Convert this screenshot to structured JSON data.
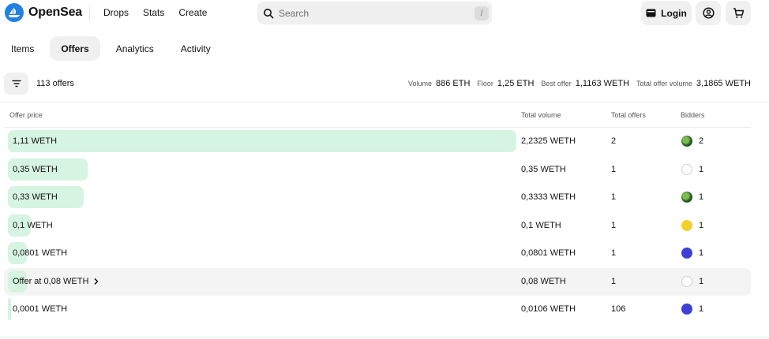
{
  "header": {
    "brand": "OpenSea",
    "nav": [
      "Drops",
      "Stats",
      "Create"
    ],
    "search_placeholder": "Search",
    "search_shortcut": "/",
    "login_label": "Login"
  },
  "tabs": [
    "Items",
    "Offers",
    "Analytics",
    "Activity"
  ],
  "active_tab": "Offers",
  "summary": {
    "offer_count": "113 offers",
    "stats": [
      {
        "label": "Volume",
        "value": "886 ETH"
      },
      {
        "label": "Floor",
        "value": "1,25 ETH"
      },
      {
        "label": "Best offer",
        "value": "1,1163 WETH"
      },
      {
        "label": "Total offer volume",
        "value": "3,1865 WETH"
      }
    ]
  },
  "table": {
    "columns": [
      "Offer price",
      "Total volume",
      "Total offers",
      "Bidders"
    ],
    "rows": [
      {
        "price": "1,11 WETH",
        "total_volume": "2,2325 WETH",
        "total_offers": "2",
        "bidders": "2",
        "avatar": "green",
        "bar_fraction": 1.0,
        "hover": false
      },
      {
        "price": "0,35 WETH",
        "total_volume": "0,35 WETH",
        "total_offers": "1",
        "bidders": "1",
        "avatar": "diamond",
        "bar_fraction": 0.157,
        "hover": false
      },
      {
        "price": "0,33 WETH",
        "total_volume": "0,3333 WETH",
        "total_offers": "1",
        "bidders": "1",
        "avatar": "green",
        "bar_fraction": 0.149,
        "hover": false
      },
      {
        "price": "0,1 WETH",
        "total_volume": "0,1 WETH",
        "total_offers": "1",
        "bidders": "1",
        "avatar": "yellow",
        "bar_fraction": 0.045,
        "hover": false
      },
      {
        "price": "0,0801 WETH",
        "total_volume": "0,0801 WETH",
        "total_offers": "1",
        "bidders": "1",
        "avatar": "blue",
        "bar_fraction": 0.036,
        "hover": false
      },
      {
        "price": "Offer at 0,08 WETH",
        "total_volume": "0,08 WETH",
        "total_offers": "1",
        "bidders": "1",
        "avatar": "diamond",
        "bar_fraction": 0.036,
        "hover": true
      },
      {
        "price": "0,0001 WETH",
        "total_volume": "0,0106 WETH",
        "total_offers": "106",
        "bidders": "1",
        "avatar": "blue",
        "bar_fraction": 0.005,
        "hover": false
      }
    ]
  },
  "colors": {
    "brand": "#2081e2",
    "bar_fill": "#d6f4e2",
    "surface": "#f0f0f0"
  }
}
